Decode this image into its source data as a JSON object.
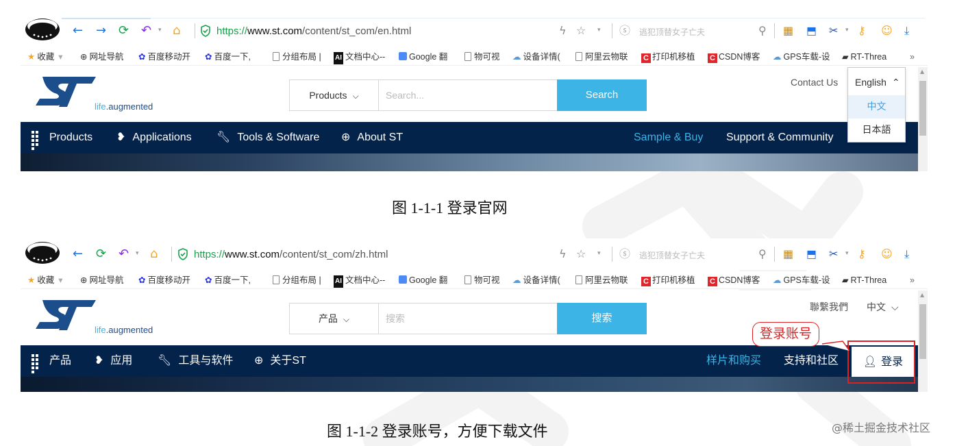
{
  "colors": {
    "st_navy": "#03234b",
    "st_cyan": "#3cb4e5",
    "annotation_red": "#e02020",
    "https_green": "#18a04b"
  },
  "browser": {
    "search_placeholder": "逃犯顶替女子亡夫",
    "bookmarks": [
      {
        "icon": "star-icon",
        "label": "收藏"
      },
      {
        "icon": "globe-icon",
        "label": "网址导航"
      },
      {
        "icon": "baidu-paw-icon",
        "label": "百度移动开"
      },
      {
        "icon": "baidu-paw-icon",
        "label": "百度一下,"
      },
      {
        "icon": "page-icon",
        "label": "分组布局 |"
      },
      {
        "icon": "ai-icon",
        "label": "文档中心--"
      },
      {
        "icon": "google-translate-icon",
        "label": "Google 翻"
      },
      {
        "icon": "page-icon",
        "label": "物可视"
      },
      {
        "icon": "cloud-icon",
        "label": "设备详情("
      },
      {
        "icon": "page-icon",
        "label": "阿里云物联"
      },
      {
        "icon": "csdn-icon",
        "label": "打印机移植"
      },
      {
        "icon": "csdn-icon",
        "label": "CSDN博客"
      },
      {
        "icon": "cloud-icon",
        "label": "GPS车载-设"
      },
      {
        "icon": "rt-thread-icon",
        "label": "RT-Threa"
      }
    ],
    "bookmarks_more": "»"
  },
  "screens": [
    {
      "url": {
        "scheme": "https://",
        "host": "www.st.com",
        "path": "/content/st_com/en.html"
      },
      "tagline": {
        "brand": "life",
        "rest": ".augmented"
      },
      "products_select": "Products",
      "search_placeholder": "Search...",
      "search_button": "Search",
      "contact": "Contact Us",
      "nav": {
        "products": "Products",
        "applications": "Applications",
        "tools": "Tools & Software",
        "about": "About ST",
        "sample_buy": "Sample & Buy",
        "support": "Support & Community"
      },
      "language_dropdown": {
        "current": "English",
        "options": [
          "中文",
          "日本語"
        ]
      },
      "caption": "图 1-1-1  登录官网"
    },
    {
      "url": {
        "scheme": "https://",
        "host": "www.st.com",
        "path": "/content/st_com/zh.html"
      },
      "tagline": {
        "brand": "life",
        "rest": ".augmented"
      },
      "products_select": "产品",
      "search_placeholder": "搜索",
      "search_button": "搜索",
      "contact": "聯繫我們",
      "language": "中文",
      "nav": {
        "products": "产品",
        "applications": "应用",
        "tools": "工具与软件",
        "about": "关于ST",
        "sample_buy": "样片和购买",
        "support": "支持和社区",
        "login": "登录"
      },
      "annotation": "登录账号",
      "caption": "图 1-1-2  登录账号，方便下载文件"
    }
  ],
  "credit": "@稀土掘金技术社区"
}
